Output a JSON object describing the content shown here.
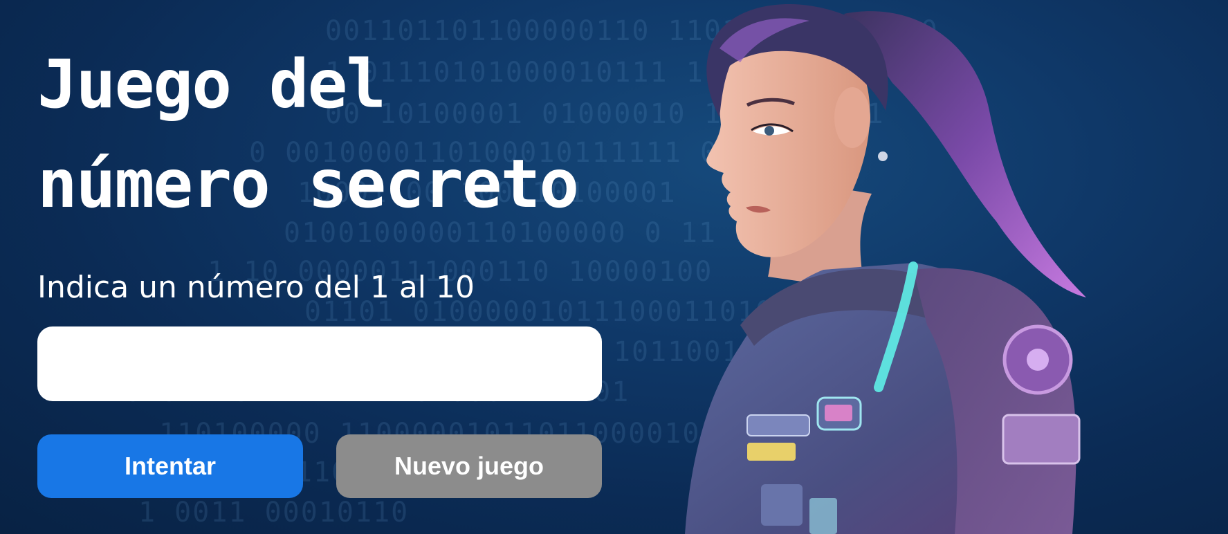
{
  "header": {
    "title_line1": "Juego del",
    "title_line2": "número secreto"
  },
  "form": {
    "prompt": "Indica un número del 1 al 10",
    "input_value": "",
    "input_placeholder": ""
  },
  "buttons": {
    "try_label": "Intentar",
    "new_game_label": "Nuevo juego"
  },
  "background": {
    "binary_rows": [
      "001101101100000110   110100000100010",
      "1  01110101000010111    1   1 0",
      "00  10100001  01000010    1000010011",
      "0   0010000110100010111111    0 10  0",
      "10001 00 100110100001",
      "0100100000110100000  0  11      100011",
      "1   10 00000111000110 10000100",
      "01101 0100000101110001101000000",
      "0111010101 1011001011010000011010",
      "0        0111011111  1110   0001111101",
      "110100000 11000001011011000010  11  1",
      "01   0 0 0    0  1101   00",
      "1                  0011  00010110"
    ]
  },
  "colors": {
    "accent_button": "#1877e6",
    "secondary_button": "#8c8c8c",
    "background_dark": "#0b2b55"
  },
  "illustration": {
    "icon": "astronaut-girl-illustration"
  }
}
